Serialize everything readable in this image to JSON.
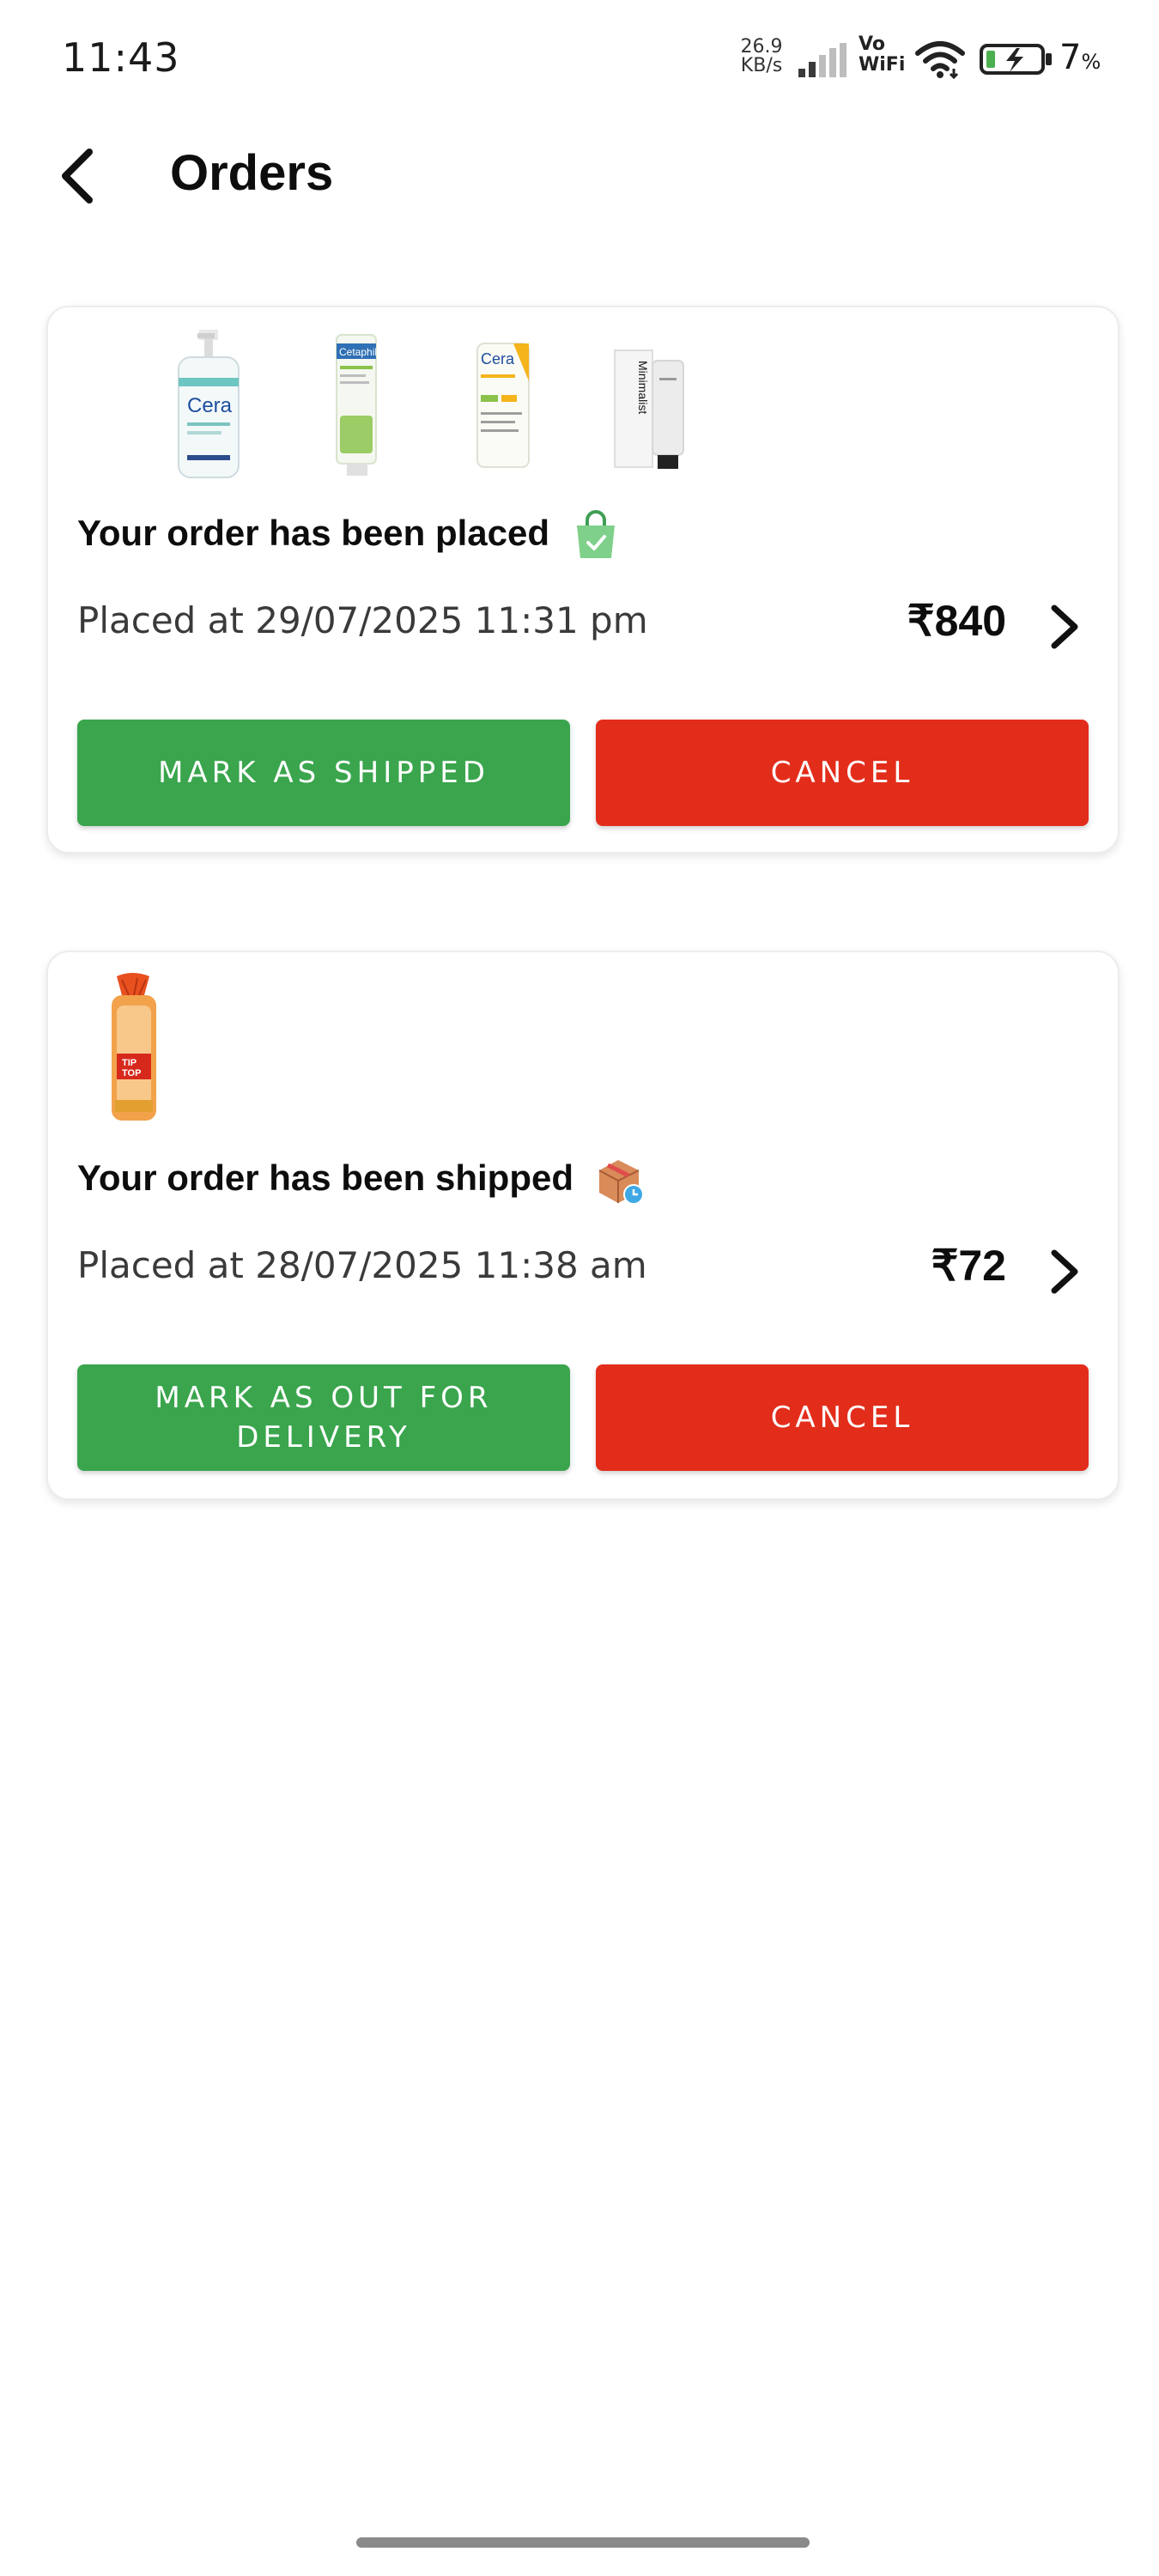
{
  "status_bar": {
    "time": "11:43",
    "net_speed_value": "26.9",
    "net_speed_unit": "KB/s",
    "vowifi_top": "Vo",
    "vowifi_bottom": "WiFi",
    "battery_percent": "7",
    "battery_symbol": "%",
    "icons": [
      "signal-icon",
      "wifi-icon",
      "battery-charging-icon"
    ]
  },
  "header": {
    "title": "Orders",
    "back_icon": "chevron-left-icon"
  },
  "orders": [
    {
      "status_text": "Your order has been placed",
      "status_icon": "shopping-bag-check-icon",
      "placed_at": "Placed at 29/07/2025 11:31 pm",
      "price": "₹840",
      "thumbnails": [
        "cleanser-bottle-thumb",
        "cetaphil-tube-thumb",
        "cerave-sunscreen-thumb",
        "minimalist-tube-thumb"
      ],
      "primary_action": "MARK AS SHIPPED",
      "secondary_action": "CANCEL"
    },
    {
      "status_text": "Your order has been shipped",
      "status_icon": "package-clock-icon",
      "placed_at": "Placed at 28/07/2025 11:38 am",
      "price": "₹72",
      "thumbnails": [
        "bread-loaf-thumb"
      ],
      "primary_action": "MARK AS OUT FOR DELIVERY",
      "secondary_action": "CANCEL"
    }
  ],
  "colors": {
    "primary_green": "#3aa54d",
    "danger_red": "#e32d1b",
    "card_border": "#ececec"
  }
}
